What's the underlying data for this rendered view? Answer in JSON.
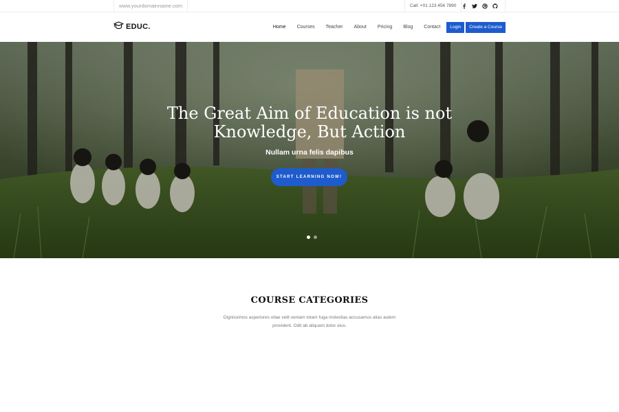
{
  "topbar": {
    "domain": "www.yourdomainname.com",
    "contact": "Call: +01 123 456 7890",
    "social": [
      "facebook-icon",
      "twitter-icon",
      "dribbble-icon",
      "github-icon"
    ]
  },
  "logo": {
    "text": "EDUC."
  },
  "nav": {
    "items": [
      "Home",
      "Courses",
      "Teacher",
      "About",
      "Pricing",
      "Blog",
      "Contact"
    ],
    "login": "Login",
    "create": "Create a Course"
  },
  "hero": {
    "title_line1": "The Great Aim of Education is not",
    "title_line2": "Knowledge, But Action",
    "subtitle": "Nullam urna felis dapibus",
    "cta": "START LEARNING NOW!",
    "slides": 2,
    "active_slide": 1
  },
  "section": {
    "heading": "COURSE CATEGORIES",
    "desc_line1": "Dignissimos asperiores vitae velit veniam totam fuga molestias accusamus alias autem",
    "desc_line2": "provident. Odit ab aliquam dolor eius."
  },
  "colors": {
    "accent": "#1e5ccd",
    "text": "#111111",
    "muted": "#777777"
  }
}
